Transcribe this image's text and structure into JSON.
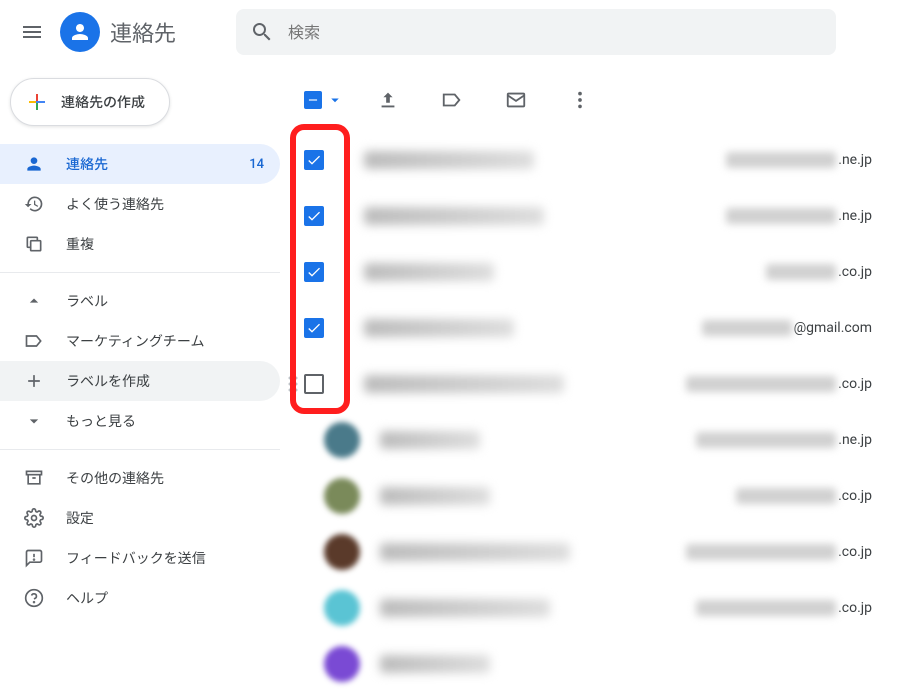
{
  "header": {
    "app_title": "連絡先",
    "search_placeholder": "検索"
  },
  "sidebar": {
    "create_label": "連絡先の作成",
    "items": [
      {
        "label": "連絡先",
        "count": "14",
        "icon": "person",
        "active": true
      },
      {
        "label": "よく使う連絡先",
        "icon": "history"
      },
      {
        "label": "重複",
        "icon": "copy"
      }
    ],
    "labels_header": "ラベル",
    "label_items": [
      {
        "label": "マーケティングチーム",
        "icon": "label"
      },
      {
        "label": "ラベルを作成",
        "icon": "plus",
        "hover": true
      }
    ],
    "more_label": "もっと見る",
    "footer": [
      {
        "label": "その他の連絡先",
        "icon": "archive"
      },
      {
        "label": "設定",
        "icon": "gear"
      },
      {
        "label": "フィードバックを送信",
        "icon": "feedback"
      },
      {
        "label": "ヘルプ",
        "icon": "help"
      }
    ]
  },
  "contacts": [
    {
      "checked": true,
      "domain": ".ne.jp",
      "name_w": 170,
      "email_w": 110,
      "avatar": "#b8c4d8"
    },
    {
      "checked": true,
      "domain": ".ne.jp",
      "name_w": 180,
      "email_w": 110,
      "avatar": "#c8b8d8"
    },
    {
      "checked": true,
      "domain": ".co.jp",
      "name_w": 130,
      "email_w": 70,
      "avatar": "#d8c4b8"
    },
    {
      "checked": true,
      "domain": "@gmail.com",
      "name_w": 150,
      "email_w": 90,
      "avatar": "#b8d8c4"
    },
    {
      "checked": false,
      "domain": ".co.jp",
      "name_w": 200,
      "email_w": 150,
      "avatar": "#d8b8c4",
      "dragging": true
    },
    {
      "has_avatar": true,
      "domain": ".ne.jp",
      "name_w": 100,
      "email_w": 140,
      "avatar": "#4a7a8a"
    },
    {
      "has_avatar": true,
      "domain": ".co.jp",
      "name_w": 110,
      "email_w": 100,
      "avatar": "#7a8a5a"
    },
    {
      "has_avatar": true,
      "domain": ".co.jp",
      "name_w": 190,
      "email_w": 150,
      "avatar": "#5a3a2a"
    },
    {
      "has_avatar": true,
      "domain": ".co.jp",
      "name_w": 170,
      "email_w": 140,
      "avatar": "#5ac4d4"
    },
    {
      "has_avatar": true,
      "domain": "",
      "name_w": 110,
      "email_w": 0,
      "avatar": "#7a4ad4"
    }
  ]
}
